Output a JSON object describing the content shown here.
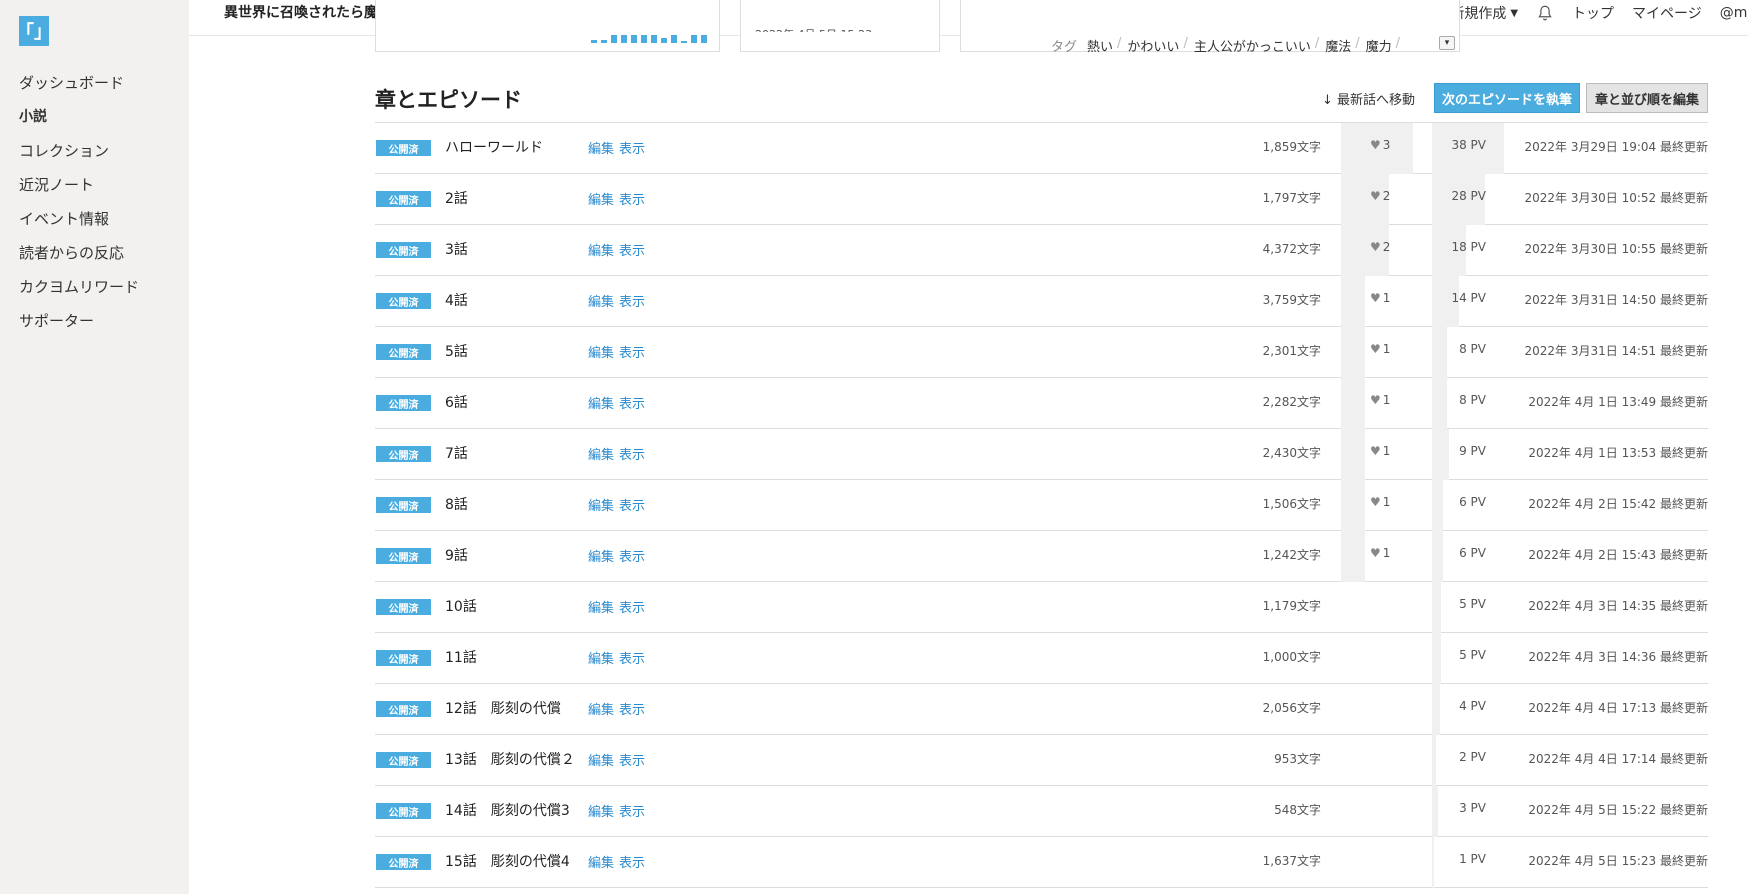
{
  "sidebar": {
    "logo": "「」",
    "items": [
      {
        "label": "ダッシュボード",
        "active": false
      },
      {
        "label": "小説",
        "active": true
      },
      {
        "label": "コレクション",
        "active": false
      },
      {
        "label": "近況ノート",
        "active": false
      },
      {
        "label": "イベント情報",
        "active": false
      },
      {
        "label": "読者からの反応",
        "active": false
      },
      {
        "label": "カクヨムリワード",
        "active": false
      },
      {
        "label": "サポーター",
        "active": false
      }
    ]
  },
  "header": {
    "title": "異世界に召喚されたら魔族だった",
    "new_label": "新規作成",
    "top_label": "トップ",
    "mypage_label": "マイページ",
    "user_label": "@ma"
  },
  "panels": {
    "mini_bars": [
      2,
      2,
      5,
      5,
      5,
      5,
      5,
      3,
      5,
      1,
      5,
      5
    ],
    "tags_label": "タグ",
    "tags": [
      "熱い",
      "かわいい",
      "主人公がかっこいい",
      "魔法",
      "魔力"
    ]
  },
  "section": {
    "title": "章とエピソード",
    "jump_label": "↓ 最新話へ移動",
    "write_next_label": "次のエピソードを執筆",
    "edit_order_label": "章と並び順を編集"
  },
  "episodes": [
    {
      "status": "公開済",
      "title": "ハローワールド",
      "edit": "編集",
      "view": "表示",
      "chars": "1,859文字",
      "hearts": "3",
      "pv": "38 PV",
      "updated": "2022年  3月29日 19:04 最終更新"
    },
    {
      "status": "公開済",
      "title": "2話",
      "edit": "編集",
      "view": "表示",
      "chars": "1,797文字",
      "hearts": "2",
      "pv": "28 PV",
      "updated": "2022年  3月30日 10:52 最終更新"
    },
    {
      "status": "公開済",
      "title": "3話",
      "edit": "編集",
      "view": "表示",
      "chars": "4,372文字",
      "hearts": "2",
      "pv": "18 PV",
      "updated": "2022年  3月30日 10:55 最終更新"
    },
    {
      "status": "公開済",
      "title": "4話",
      "edit": "編集",
      "view": "表示",
      "chars": "3,759文字",
      "hearts": "1",
      "pv": "14 PV",
      "updated": "2022年  3月31日 14:50 最終更新"
    },
    {
      "status": "公開済",
      "title": "5話",
      "edit": "編集",
      "view": "表示",
      "chars": "2,301文字",
      "hearts": "1",
      "pv": "8 PV",
      "updated": "2022年  3月31日 14:51 最終更新"
    },
    {
      "status": "公開済",
      "title": "6話",
      "edit": "編集",
      "view": "表示",
      "chars": "2,282文字",
      "hearts": "1",
      "pv": "8 PV",
      "updated": "2022年  4月  1日 13:49 最終更新"
    },
    {
      "status": "公開済",
      "title": "7話",
      "edit": "編集",
      "view": "表示",
      "chars": "2,430文字",
      "hearts": "1",
      "pv": "9 PV",
      "updated": "2022年  4月  1日 13:53 最終更新"
    },
    {
      "status": "公開済",
      "title": "8話",
      "edit": "編集",
      "view": "表示",
      "chars": "1,506文字",
      "hearts": "1",
      "pv": "6 PV",
      "updated": "2022年  4月  2日 15:42 最終更新"
    },
    {
      "status": "公開済",
      "title": "9話",
      "edit": "編集",
      "view": "表示",
      "chars": "1,242文字",
      "hearts": "1",
      "pv": "6 PV",
      "updated": "2022年  4月  2日 15:43 最終更新"
    },
    {
      "status": "公開済",
      "title": "10話",
      "edit": "編集",
      "view": "表示",
      "chars": "1,179文字",
      "hearts": "",
      "pv": "5 PV",
      "updated": "2022年  4月  3日 14:35 最終更新"
    },
    {
      "status": "公開済",
      "title": "11話",
      "edit": "編集",
      "view": "表示",
      "chars": "1,000文字",
      "hearts": "",
      "pv": "5 PV",
      "updated": "2022年  4月  3日 14:36 最終更新"
    },
    {
      "status": "公開済",
      "title": "12話　彫刻の代償",
      "edit": "編集",
      "view": "表示",
      "chars": "2,056文字",
      "hearts": "",
      "pv": "4 PV",
      "updated": "2022年  4月  4日 17:13 最終更新"
    },
    {
      "status": "公開済",
      "title": "13話　彫刻の代償２",
      "edit": "編集",
      "view": "表示",
      "chars": "953文字",
      "hearts": "",
      "pv": "2 PV",
      "updated": "2022年  4月  4日 17:14 最終更新"
    },
    {
      "status": "公開済",
      "title": "14話　彫刻の代償3",
      "edit": "編集",
      "view": "表示",
      "chars": "548文字",
      "hearts": "",
      "pv": "3 PV",
      "updated": "2022年  4月  5日 15:22 最終更新"
    },
    {
      "status": "公開済",
      "title": "15話　彫刻の代償4",
      "edit": "編集",
      "view": "表示",
      "chars": "1,637文字",
      "hearts": "",
      "pv": "1 PV",
      "updated": "2022年  4月  5日 15:23 最終更新"
    }
  ]
}
